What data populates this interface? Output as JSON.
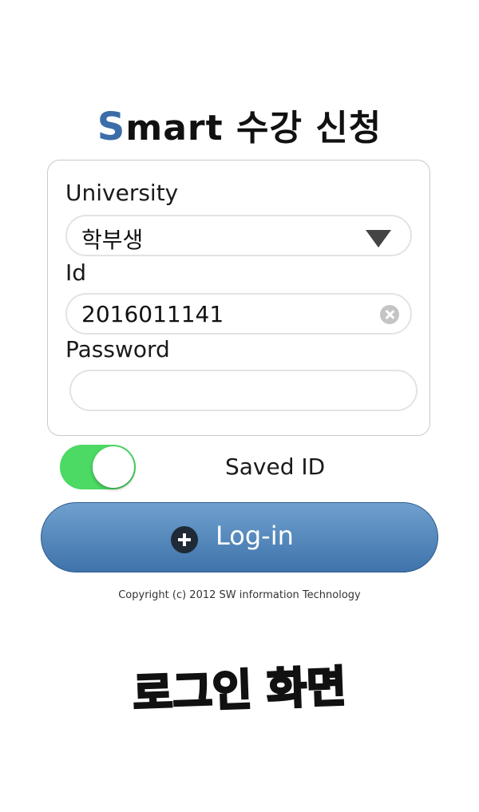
{
  "app": {
    "title_s": "S",
    "title_rest": "mart 수강 신청"
  },
  "form": {
    "university_label": "University",
    "university_value": "학부생",
    "id_label": "Id",
    "id_value": "2016011141",
    "password_label": "Password",
    "password_value": ""
  },
  "saved_id": {
    "label": "Saved ID",
    "enabled": true
  },
  "login_button": {
    "label": "Log-in",
    "icon": "plus-circle-icon"
  },
  "footer": {
    "copyright": "Copyright (c) 2012 SW information Technology"
  },
  "caption": "로그인 화면",
  "colors": {
    "brand_s": "#3b6ea8",
    "toggle_on": "#4cd964",
    "button_top": "#6fa0cf",
    "button_bottom": "#3f73aa"
  }
}
